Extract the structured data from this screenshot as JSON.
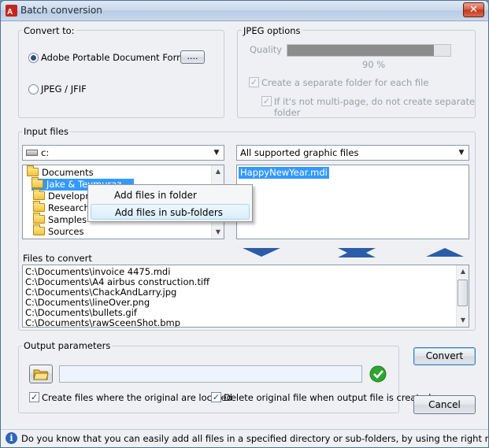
{
  "window": {
    "title": "Batch conversion",
    "close_glyph": "✕"
  },
  "convert_to": {
    "title": "Convert to:",
    "options": [
      {
        "label": "Adobe Portable Document Format",
        "checked": true
      },
      {
        "label": "JPEG / JFIF",
        "checked": false
      }
    ],
    "browse_label": "...."
  },
  "jpeg_options": {
    "title": "JPEG options",
    "quality_label": "Quality",
    "quality_value": "90 %",
    "quality_fraction": 0.9,
    "separate_folder_label": "Create a separate folder for each file",
    "not_multipage_label": "If it's not multi-page, do not create separate folder"
  },
  "input_files": {
    "title": "Input files",
    "drive": "c:",
    "filter": "All supported graphic files",
    "tree": [
      "Documents",
      "Jake & Teymuraz",
      "Developme",
      "Research",
      "Samples",
      "Sources"
    ],
    "selected_tree_item": "Jake & Teymuraz",
    "files": [
      "HappyNewYear.mdi"
    ],
    "selected_file": "HappyNewYear.mdi"
  },
  "context_menu": {
    "items": [
      "Add files in folder",
      "Add files in sub-folders"
    ],
    "hover_index": 1
  },
  "files_to_convert": {
    "title": "Files to convert",
    "items": [
      "C:\\Documents\\invoice 4475.mdi",
      "C:\\Documents\\A4 airbus construction.tiff",
      "C:\\Documents\\ChackAndLarry.jpg",
      "C:\\Documents\\lineOver.png",
      "C:\\Documents\\bullets.gif",
      "C:\\Documents\\rawSceenShot.bmp"
    ]
  },
  "output_parameters": {
    "title": "Output parameters",
    "path_value": "",
    "create_where_original_label": "Create files where the original are located",
    "delete_original_label": "Delete original file when output file is created"
  },
  "buttons": {
    "convert": "Convert",
    "cancel": "Cancel"
  },
  "status": {
    "tip": "Do you know that you can easily add all files in a specified directory or sub-folders, by using the right mouse button?"
  },
  "colors": {
    "selection": "#3399ff",
    "quality_bar": "#8c8c8c",
    "ok_green": "#2fa52f",
    "arrow_blue": "#2b5ca8"
  }
}
